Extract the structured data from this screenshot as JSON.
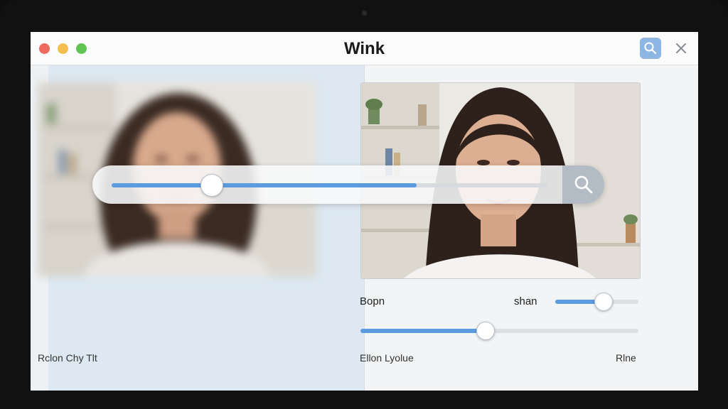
{
  "window": {
    "title": "Wink",
    "search_icon": "search-icon",
    "close_icon": "close-icon",
    "close_glyph": "✕"
  },
  "overlay_slider": {
    "value_fraction": 0.23,
    "buffer_fraction": 0.7,
    "search_icon": "search-icon"
  },
  "controls": {
    "label_left": "Bopn",
    "label_right": "shan",
    "slider_small_fraction": 0.58,
    "slider_wide_fraction": 0.45
  },
  "footer_cut_text": {
    "left": "Rclon Chy Tlt",
    "middle": "Ellon Lyolue",
    "right": "Rlne"
  },
  "colors": {
    "accent": "#5b9be0",
    "search_button": "#8db6e3",
    "left_pane": "#dde8f2"
  }
}
